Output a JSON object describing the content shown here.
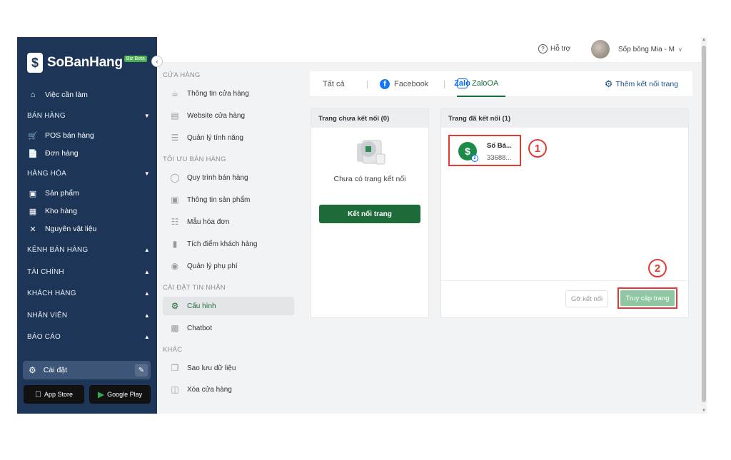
{
  "sidebar": {
    "brand": "SoBanHang",
    "brand_badge": "Biz Beta",
    "top_item": "Việc cần làm",
    "sections": [
      {
        "label": "BÁN HÀNG",
        "items": [
          "POS bán hàng",
          "Đơn hàng"
        ]
      },
      {
        "label": "HÀNG HÓA",
        "items": [
          "Sản phẩm",
          "Kho hàng",
          "Nguyên vật liệu"
        ]
      },
      {
        "label": "KÊNH BÁN HÀNG"
      },
      {
        "label": "TÀI CHÍNH"
      },
      {
        "label": "KHÁCH HÀNG"
      },
      {
        "label": "NHÂN VIÊN"
      },
      {
        "label": "BÁO CÁO"
      }
    ],
    "settings_label": "Cài đặt",
    "app_store": "App Store",
    "google_play": "Google Play"
  },
  "settings_menu": {
    "sections": [
      {
        "label": "CỬA HÀNG",
        "items": [
          "Thông tin cửa hàng",
          "Website cửa hàng",
          "Quản lý tính năng"
        ]
      },
      {
        "label": "TỐI ƯU BÁN HÀNG",
        "items": [
          "Quy trình bán hàng",
          "Thông tin sản phẩm",
          "Mẫu hóa đơn",
          "Tích điểm khách hàng",
          "Quản lý phụ phí"
        ]
      },
      {
        "label": "CÀI ĐẶT TIN NHẮN",
        "items": [
          "Cấu hình",
          "Chatbot"
        ]
      },
      {
        "label": "KHÁC",
        "items": [
          "Sao lưu dữ liệu",
          "Xóa cửa hàng"
        ]
      }
    ],
    "active_item": "Cấu hình"
  },
  "topbar": {
    "help": "Hỗ trợ",
    "user_name": "Sốp bông Mia - M"
  },
  "tabs": {
    "all": "Tất cả",
    "facebook": "Facebook",
    "zalo": "ZaloOA",
    "zalo_logo_text": "Zalo",
    "add_connect": "Thêm kết nối trang"
  },
  "unconnected": {
    "title": "Trang chưa kết nối (0)",
    "empty_text": "Chưa có trang kết nối",
    "connect_button": "Kết nối trang"
  },
  "connected": {
    "title": "Trang đã kết nối (1)",
    "page_name": "Số Bá...",
    "page_id": "33688...",
    "disconnect_button": "Gỡ kết nối",
    "visit_button": "Truy cập trang"
  },
  "annotations": {
    "one": "1",
    "two": "2"
  }
}
